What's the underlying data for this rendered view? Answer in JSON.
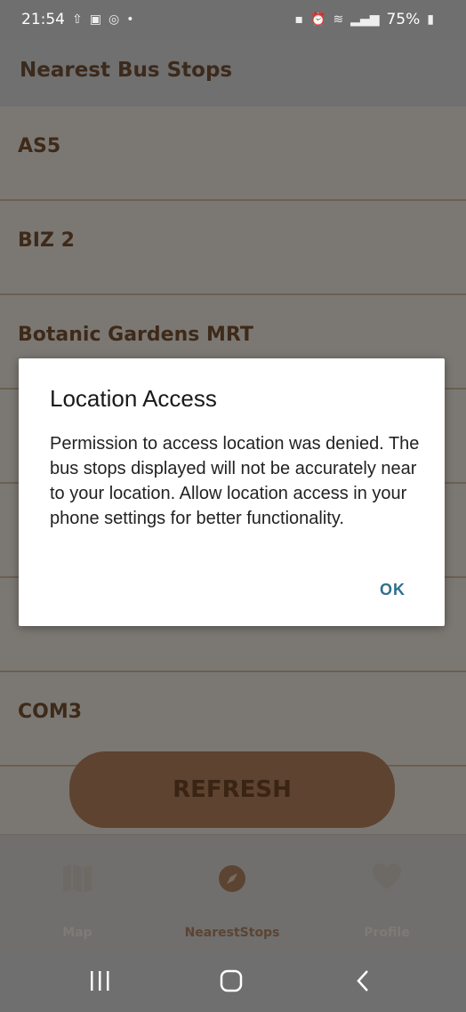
{
  "status_bar": {
    "time": "21:54",
    "battery": "75%"
  },
  "app_bar": {
    "title": "Nearest Bus Stops"
  },
  "stops": [
    {
      "label": "AS5"
    },
    {
      "label": "BIZ 2"
    },
    {
      "label": "Botanic Gardens MRT"
    },
    {
      "label": ""
    },
    {
      "label": ""
    },
    {
      "label": ""
    },
    {
      "label": "COM3"
    }
  ],
  "refresh_label": "REFRESH",
  "bottom_nav": {
    "items": [
      {
        "label": "Map",
        "icon": "map-icon"
      },
      {
        "label": "NearestStops",
        "icon": "compass-icon"
      },
      {
        "label": "Profile",
        "icon": "heart-icon"
      }
    ],
    "active_index": 1
  },
  "dialog": {
    "title": "Location Access",
    "body": "Permission to access location was denied. The bus stops displayed will not be accurately near to your location. Allow location access in your phone settings for better functionality.",
    "ok_label": "OK"
  },
  "colors": {
    "accent_dark": "#5e4330",
    "dialog_button": "#2f6f8f"
  }
}
